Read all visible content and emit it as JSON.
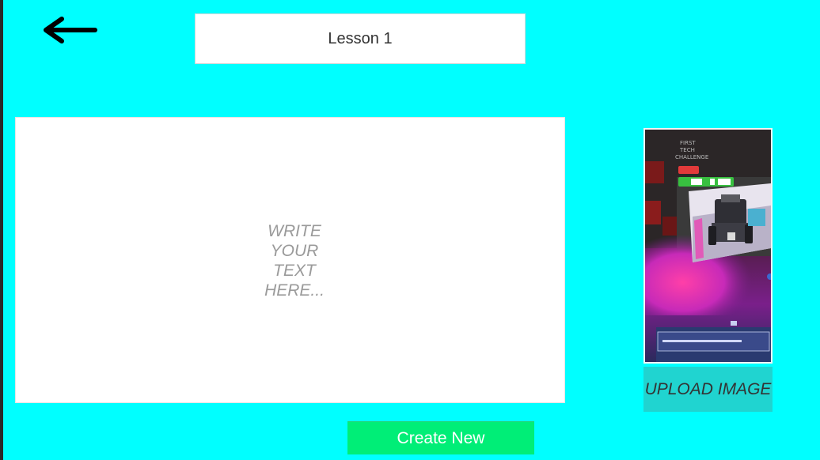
{
  "header": {
    "back_icon": "arrow-left-icon",
    "lesson_title": "Lesson 1"
  },
  "editor": {
    "placeholder": "WRITE YOUR TEXT HERE..."
  },
  "image_upload": {
    "preview_photo": "robot-on-field-photo",
    "photo_text_lines": [
      "FIRST",
      "TECH",
      "CHALLENGE"
    ],
    "upload_label": "UPLOAD IMAGE"
  },
  "actions": {
    "create_label": "Create New"
  },
  "colors": {
    "background": "#00ffff",
    "upload_button": "#20d4d0",
    "create_button": "#00ee77"
  }
}
